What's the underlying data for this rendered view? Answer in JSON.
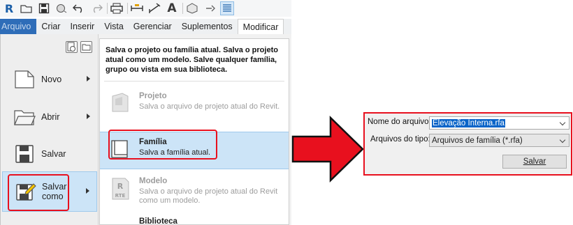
{
  "ribbon": {
    "tabs": [
      "Arquivo",
      "Criar",
      "Inserir",
      "Vista",
      "Gerenciar",
      "Suplementos",
      "Modificar"
    ],
    "active_tab": "Modificar"
  },
  "qat": {
    "logo": "R",
    "text_tool": "A"
  },
  "file_menu": {
    "left_items": [
      {
        "label": "Novo",
        "has_submenu": true
      },
      {
        "label": "Abrir",
        "has_submenu": true
      },
      {
        "label": "Salvar",
        "has_submenu": false
      },
      {
        "label_line1": "Salvar",
        "label_line2": "como",
        "has_submenu": true,
        "selected": true
      },
      {}
    ],
    "description": "Salva o projeto ou família atual. Salva o projeto atual como um modelo. Salve qualquer família, grupo ou vista em sua biblioteca.",
    "right_items": [
      {
        "title": "Projeto",
        "desc": "Salva o arquivo de projeto atual do Revit.",
        "enabled": false
      },
      {
        "title": "Família",
        "desc": "Salva a família atual.",
        "enabled": true,
        "selected": true
      },
      {
        "title": "Modelo",
        "desc": "Salva o arquivo de projeto atual do Revit como um modelo.",
        "enabled": false,
        "icon_text": "RTE"
      },
      {
        "title": "Biblioteca",
        "desc": "",
        "enabled": true
      }
    ]
  },
  "save_dialog": {
    "filename_label": "Nome do arquivo:",
    "filename_value": "Elevação Interna.rfa",
    "filetype_label": "Arquivos do tipo:",
    "filetype_value": "Arquivos de família  (*.rfa)",
    "save_button": "Salvar"
  },
  "colors": {
    "highlight_red": "#e8101e",
    "selection_blue": "#cce4f7",
    "file_tab_blue": "#2e6db8"
  }
}
